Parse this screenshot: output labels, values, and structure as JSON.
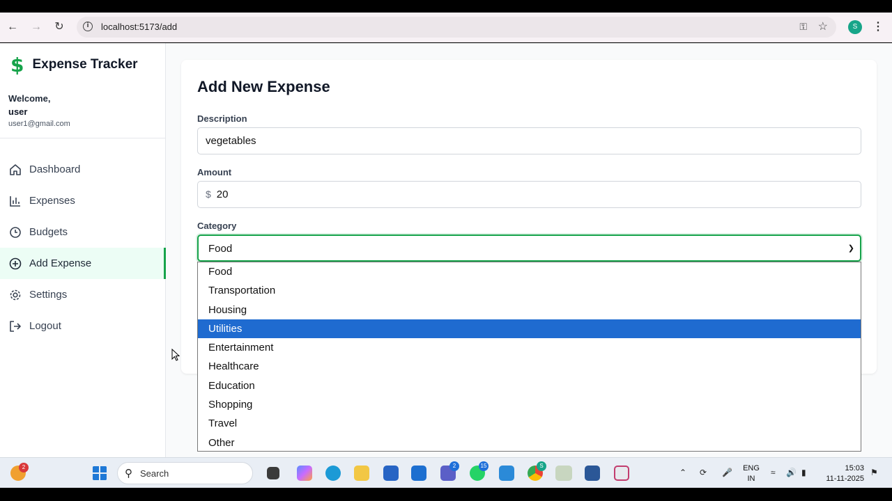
{
  "browser": {
    "url": "localhost:5173/add",
    "profile_initial": "S"
  },
  "sidebar": {
    "brand": "Expense Tracker",
    "welcome": "Welcome,",
    "username": "user",
    "email": "user1@gmail.com",
    "items": [
      {
        "label": "Dashboard",
        "icon": "home-icon"
      },
      {
        "label": "Expenses",
        "icon": "bar-chart-icon"
      },
      {
        "label": "Budgets",
        "icon": "wallet-icon"
      },
      {
        "label": "Add Expense",
        "icon": "plus-circle-icon",
        "active": true
      },
      {
        "label": "Settings",
        "icon": "gear-icon"
      },
      {
        "label": "Logout",
        "icon": "logout-icon"
      }
    ]
  },
  "form": {
    "title": "Add New Expense",
    "description_label": "Description",
    "description_value": "vegetables",
    "amount_label": "Amount",
    "currency_symbol": "$",
    "amount_value": "20",
    "category_label": "Category",
    "category_value": "Food"
  },
  "dropdown": {
    "options": [
      "Food",
      "Transportation",
      "Housing",
      "Utilities",
      "Entertainment",
      "Healthcare",
      "Education",
      "Shopping",
      "Travel",
      "Other"
    ],
    "highlighted": "Utilities"
  },
  "taskbar": {
    "search_placeholder": "Search",
    "widgets_badge": "2",
    "teams_badge": "2",
    "whatsapp_badge": "15",
    "chrome_badge": "S",
    "lang_top": "ENG",
    "lang_bottom": "IN",
    "time": "15:03",
    "date": "11-11-2025"
  },
  "colors": {
    "accent_green": "#16a34a",
    "highlight_blue": "#1f6bd0"
  }
}
